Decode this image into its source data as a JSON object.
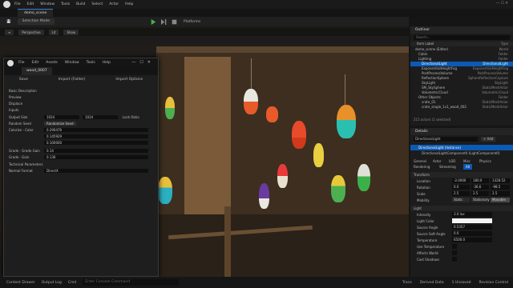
{
  "menubar": {
    "items": [
      "File",
      "Edit",
      "Window",
      "Tools",
      "Build",
      "Select",
      "Actor",
      "Help"
    ],
    "settings_label": "Settings"
  },
  "level_tab": "demo_scene",
  "toolbar": {
    "mode_label": "Selection Mode",
    "platforms_label": "Platforms"
  },
  "viewport_bar": [
    "Perspective",
    "Lit",
    "Show"
  ],
  "dialog": {
    "menu": [
      "File",
      "Edit",
      "Assets",
      "Window",
      "Tools",
      "Help"
    ],
    "tab": "wood_0007",
    "buttons": [
      "Save",
      "Import (Folder)",
      "Import Options"
    ],
    "section_basic": "Basic Description",
    "section_preview": "Preview",
    "section_displace": "Displace",
    "section_inputs": "Inputs",
    "props": [
      {
        "label": "Output Size",
        "value": "1024"
      },
      {
        "label": "Random Seed",
        "value": "Randomize Seed"
      },
      {
        "label": "Colorize - Color",
        "value": "0.290476"
      },
      {
        "label": "",
        "value": "0.145929"
      },
      {
        "label": "",
        "value": "0.100000"
      },
      {
        "label": "Grade - Grade Gain",
        "value": "0.14"
      },
      {
        "label": "Grade - Gain",
        "value": "0.136"
      },
      {
        "label": "Normal Format",
        "value": "DirectX"
      }
    ],
    "output_size_y": "1024",
    "lock_ratio": "Lock Ratio",
    "section_technical": "Technical Parameters"
  },
  "outliner": {
    "title": "Outliner",
    "search_placeholder": "Search...",
    "col_label": "Item Label",
    "col_type": "Type",
    "rows": [
      {
        "label": "demo_scene (Editor)",
        "type": "World"
      },
      {
        "label": "Cabin",
        "type": "Folder"
      },
      {
        "label": "Lighting",
        "type": "Folder"
      },
      {
        "label": "DirectionalLight",
        "type": "DirectionalLight"
      },
      {
        "label": "ExponentialHeightFog",
        "type": "ExponentialHeightFog"
      },
      {
        "label": "PostProcessVolume",
        "type": "PostProcessVolume"
      },
      {
        "label": "ReflectionSphere",
        "type": "SphereReflectionCapture"
      },
      {
        "label": "SkyLight",
        "type": "SkyLight"
      },
      {
        "label": "SM_SkySphere",
        "type": "StaticMeshActor"
      },
      {
        "label": "VolumetricCloud",
        "type": "VolumetricCloud"
      },
      {
        "label": "Other Objects",
        "type": "Folder"
      },
      {
        "label": "crate_01",
        "type": "StaticMeshActor"
      },
      {
        "label": "crate_single_1x1_wood_002",
        "type": "StaticMeshActor"
      }
    ],
    "footer": "215 actors (1 selected)"
  },
  "details": {
    "title": "Details",
    "actor_name": "DirectionalLight",
    "add_label": "+ Add",
    "component": "DirectionalLight (Instance)",
    "subcomponent": "DirectionalLightComponent0 (LightComponent0)",
    "filter_tabs": [
      "General",
      "Actor",
      "LOD",
      "Misc",
      "Physics",
      "Rendering",
      "Streaming",
      "All"
    ],
    "section_transform": "Transform",
    "transform": [
      {
        "label": "Location",
        "values": [
          "-2.0000",
          "180.0",
          "1328.52"
        ]
      },
      {
        "label": "Rotation",
        "values": [
          "0.0",
          "-36.6",
          "-98.5"
        ]
      },
      {
        "label": "Scale",
        "values": [
          "2.5",
          "2.5",
          "2.5"
        ]
      }
    ],
    "mobility": {
      "label": "Mobility",
      "options": [
        "Static",
        "Stationary",
        "Movable"
      ]
    },
    "section_light": "Light",
    "light": [
      {
        "label": "Intensity",
        "value": "3.0 lux"
      },
      {
        "label": "Light Color",
        "value": ""
      },
      {
        "label": "Source Angle",
        "value": "0.5357"
      },
      {
        "label": "Source Soft Angle",
        "value": "0.0"
      },
      {
        "label": "Temperature",
        "value": "6500.0"
      },
      {
        "label": "Use Temperature",
        "value": ""
      },
      {
        "label": "Affects World",
        "value": ""
      },
      {
        "label": "Cast Shadows",
        "value": ""
      }
    ]
  },
  "bottombar": {
    "left": [
      "Content Drawer",
      "Output Log",
      "Cmd"
    ],
    "console_placeholder": "Enter Console Command",
    "right": [
      "Trace",
      "Derived Data",
      "1 Unsaved",
      "Revision Control"
    ]
  }
}
